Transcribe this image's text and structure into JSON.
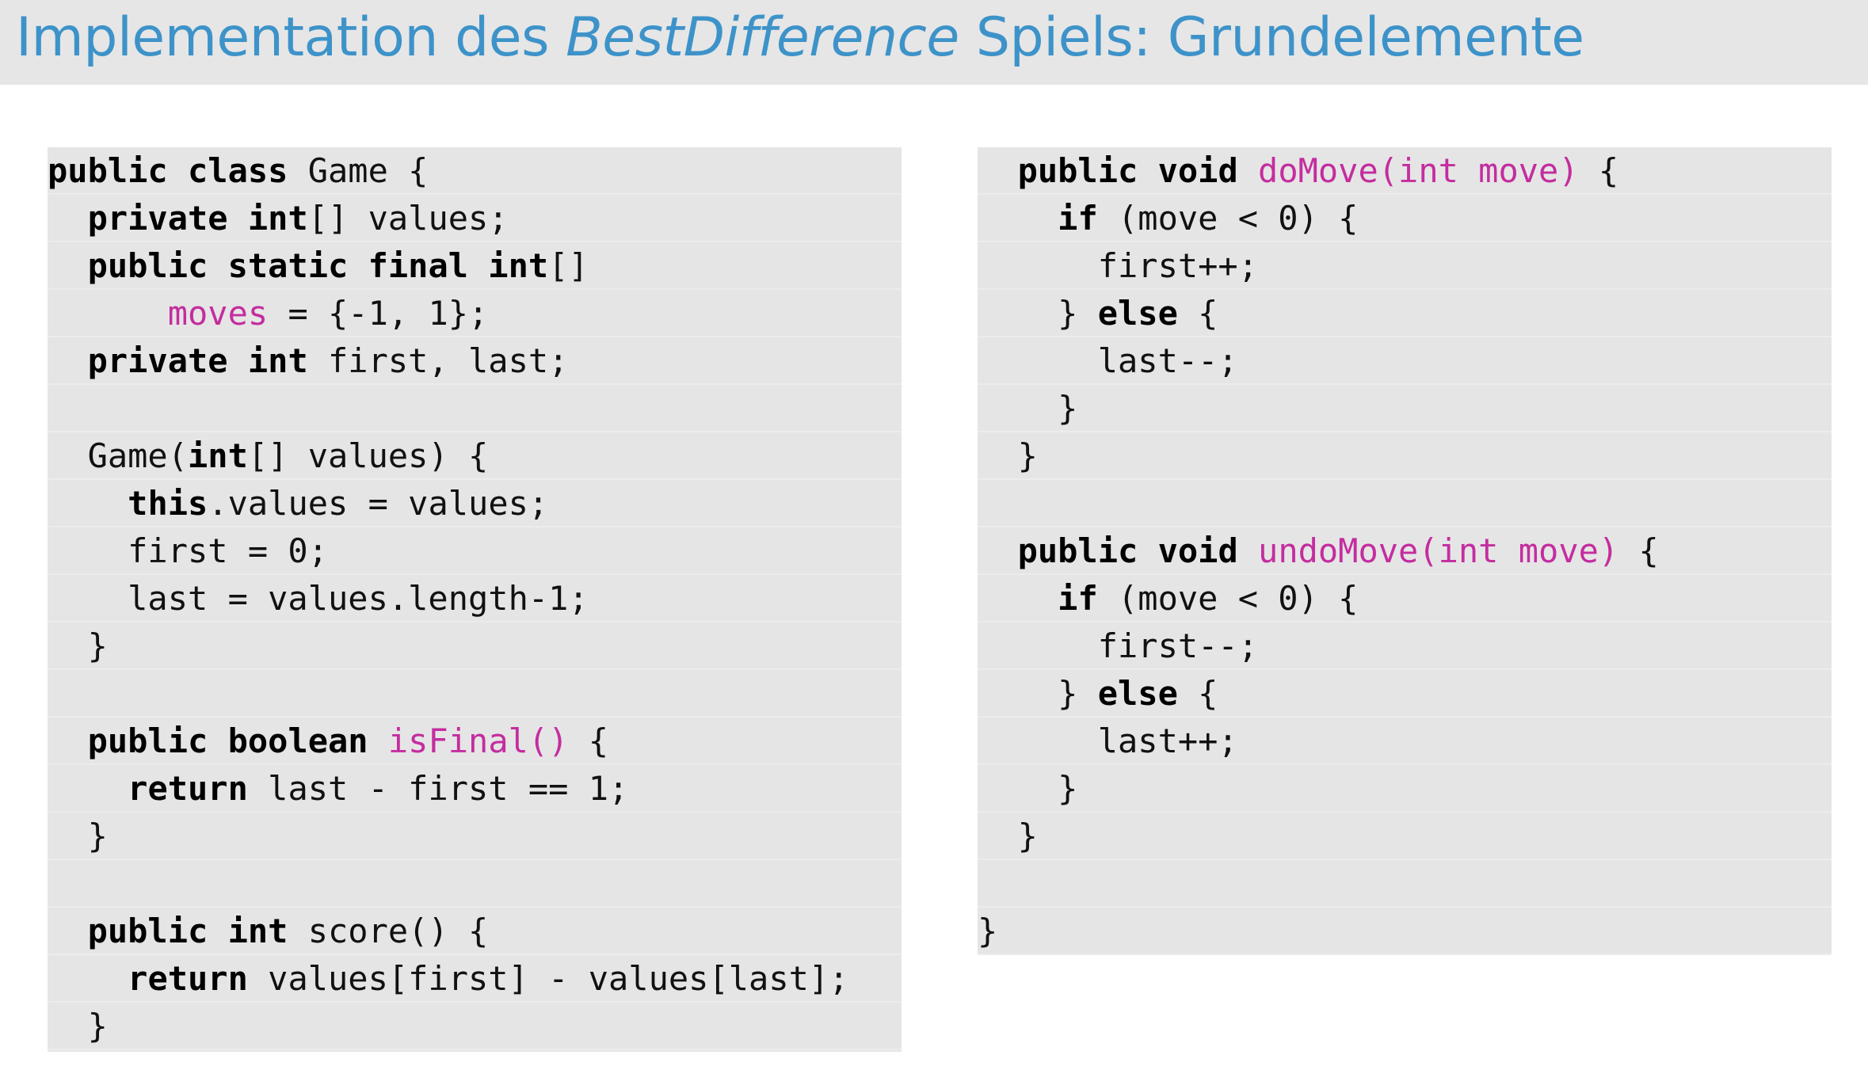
{
  "slide": {
    "title_parts": [
      {
        "text": "Implementation des ",
        "italic": false
      },
      {
        "text": "BestDifference",
        "italic": true
      },
      {
        "text": " Spiels: Grundelemente",
        "italic": false
      }
    ]
  },
  "colors": {
    "title": "#3d93c9",
    "title_bar_bg": "#e6e6e6",
    "code_bg": "#e5e5e5",
    "keyword": "#000000",
    "highlight": "#c42d9f",
    "text": "#111111"
  },
  "code": {
    "left": [
      [
        [
          "kw",
          "public class"
        ],
        [
          "tx",
          " Game {"
        ]
      ],
      [
        [
          "tx",
          "  "
        ],
        [
          "kw",
          "private int"
        ],
        [
          "tx",
          "[] values;"
        ]
      ],
      [
        [
          "tx",
          "  "
        ],
        [
          "kw",
          "public static final int"
        ],
        [
          "tx",
          "[]"
        ]
      ],
      [
        [
          "tx",
          "      "
        ],
        [
          "hl",
          "moves"
        ],
        [
          "tx",
          " = {-1, 1};"
        ]
      ],
      [
        [
          "tx",
          "  "
        ],
        [
          "kw",
          "private int"
        ],
        [
          "tx",
          " first, last;"
        ]
      ],
      [],
      [
        [
          "tx",
          "  Game("
        ],
        [
          "kw",
          "int"
        ],
        [
          "tx",
          "[] values) {"
        ]
      ],
      [
        [
          "tx",
          "    "
        ],
        [
          "kw",
          "this"
        ],
        [
          "tx",
          ".values = values;"
        ]
      ],
      [
        [
          "tx",
          "    first = 0;"
        ]
      ],
      [
        [
          "tx",
          "    last = values.length-1;"
        ]
      ],
      [
        [
          "tx",
          "  }"
        ]
      ],
      [],
      [
        [
          "tx",
          "  "
        ],
        [
          "kw",
          "public boolean"
        ],
        [
          "tx",
          " "
        ],
        [
          "hl",
          "isFinal()"
        ],
        [
          "tx",
          " {"
        ]
      ],
      [
        [
          "tx",
          "    "
        ],
        [
          "kw",
          "return"
        ],
        [
          "tx",
          " last - first == 1;"
        ]
      ],
      [
        [
          "tx",
          "  }"
        ]
      ],
      [],
      [
        [
          "tx",
          "  "
        ],
        [
          "kw",
          "public int"
        ],
        [
          "tx",
          " score() {"
        ]
      ],
      [
        [
          "tx",
          "    "
        ],
        [
          "kw",
          "return"
        ],
        [
          "tx",
          " values[first] - values[last];"
        ]
      ],
      [
        [
          "tx",
          "  }"
        ]
      ]
    ],
    "right": [
      [
        [
          "tx",
          "  "
        ],
        [
          "kw",
          "public void"
        ],
        [
          "tx",
          " "
        ],
        [
          "hl",
          "doMove(int move)"
        ],
        [
          "tx",
          " {"
        ]
      ],
      [
        [
          "tx",
          "    "
        ],
        [
          "kw",
          "if"
        ],
        [
          "tx",
          " (move < 0) {"
        ]
      ],
      [
        [
          "tx",
          "      first++;"
        ]
      ],
      [
        [
          "tx",
          "    } "
        ],
        [
          "kw",
          "else"
        ],
        [
          "tx",
          " {"
        ]
      ],
      [
        [
          "tx",
          "      last--;"
        ]
      ],
      [
        [
          "tx",
          "    }"
        ]
      ],
      [
        [
          "tx",
          "  }"
        ]
      ],
      [],
      [
        [
          "tx",
          "  "
        ],
        [
          "kw",
          "public void"
        ],
        [
          "tx",
          " "
        ],
        [
          "hl",
          "undoMove(int move)"
        ],
        [
          "tx",
          " {"
        ]
      ],
      [
        [
          "tx",
          "    "
        ],
        [
          "kw",
          "if"
        ],
        [
          "tx",
          " (move < 0) {"
        ]
      ],
      [
        [
          "tx",
          "      first--;"
        ]
      ],
      [
        [
          "tx",
          "    } "
        ],
        [
          "kw",
          "else"
        ],
        [
          "tx",
          " {"
        ]
      ],
      [
        [
          "tx",
          "      last++;"
        ]
      ],
      [
        [
          "tx",
          "    }"
        ]
      ],
      [
        [
          "tx",
          "  }"
        ]
      ],
      [],
      [
        [
          "tx",
          "}"
        ]
      ]
    ]
  }
}
